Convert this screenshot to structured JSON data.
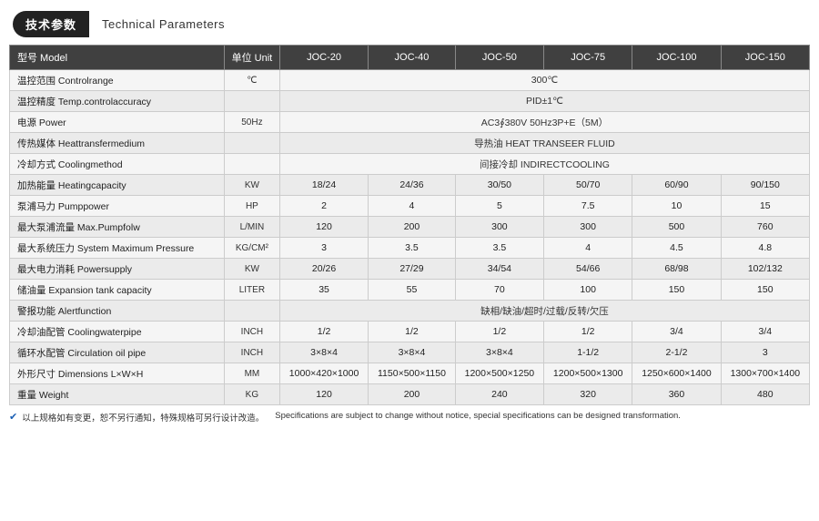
{
  "header": {
    "badge": "技术参数",
    "title": "Technical Parameters"
  },
  "table": {
    "columns": [
      "型号 Model",
      "单位 Unit",
      "JOC-20",
      "JOC-40",
      "JOC-50",
      "JOC-75",
      "JOC-100",
      "JOC-150"
    ],
    "rows": [
      {
        "label": "温控范围 Controlrange",
        "unit": "℃",
        "merged": true,
        "mergedValue": "300℃",
        "cols": 6
      },
      {
        "label": "温控精度 Temp.controlaccuracy",
        "unit": "",
        "merged": true,
        "mergedValue": "PID±1℃",
        "cols": 6
      },
      {
        "label": "电源 Power",
        "unit": "50Hz",
        "merged": true,
        "mergedValue": "AC3∮380V 50Hz3P+E（5M）",
        "cols": 6
      },
      {
        "label": "传热媒体 Heattransfermedium",
        "unit": "",
        "merged": true,
        "mergedValue": "导热油 HEAT TRANSEER FLUID",
        "cols": 6
      },
      {
        "label": "冷却方式 Coolingmethod",
        "unit": "",
        "merged": true,
        "mergedValue": "间接冷却 INDIRECTCOOLING",
        "cols": 6
      },
      {
        "label": "加热能量 Heatingcapacity",
        "unit": "KW",
        "merged": false,
        "values": [
          "18/24",
          "24/36",
          "30/50",
          "50/70",
          "60/90",
          "90/150"
        ]
      },
      {
        "label": "泵浦马力 Pumppower",
        "unit": "HP",
        "merged": false,
        "values": [
          "2",
          "4",
          "5",
          "7.5",
          "10",
          "15"
        ]
      },
      {
        "label": "最大泵浦流量 Max.Pumpfolw",
        "unit": "L/MIN",
        "merged": false,
        "values": [
          "120",
          "200",
          "300",
          "300",
          "500",
          "760"
        ]
      },
      {
        "label": "最大系统压力 System Maximum Pressure",
        "unit": "KG/CM²",
        "merged": false,
        "values": [
          "3",
          "3.5",
          "3.5",
          "4",
          "4.5",
          "4.8"
        ]
      },
      {
        "label": "最大电力消耗 Powersupply",
        "unit": "KW",
        "merged": false,
        "values": [
          "20/26",
          "27/29",
          "34/54",
          "54/66",
          "68/98",
          "102/132"
        ]
      },
      {
        "label": "储油量 Expansion tank capacity",
        "unit": "LITER",
        "merged": false,
        "values": [
          "35",
          "55",
          "70",
          "100",
          "150",
          "150"
        ]
      },
      {
        "label": "警报功能 Alertfunction",
        "unit": "",
        "merged": true,
        "mergedValue": "缺相/缺油/超时/过载/反转/欠压",
        "cols": 6
      },
      {
        "label": "冷却油配管 Coolingwaterpipe",
        "unit": "INCH",
        "merged": false,
        "values": [
          "1/2",
          "1/2",
          "1/2",
          "1/2",
          "3/4",
          "3/4"
        ]
      },
      {
        "label": "循环水配管 Circulation oil pipe",
        "unit": "INCH",
        "merged": false,
        "values": [
          "3×8×4",
          "3×8×4",
          "3×8×4",
          "1-1/2",
          "2-1/2",
          "3"
        ]
      },
      {
        "label": "外形尺寸 Dimensions L×W×H",
        "unit": "MM",
        "merged": false,
        "values": [
          "1000×420×1000",
          "1150×500×1150",
          "1200×500×1250",
          "1200×500×1300",
          "1250×600×1400",
          "1300×700×1400"
        ]
      },
      {
        "label": "重量 Weight",
        "unit": "KG",
        "merged": false,
        "values": [
          "120",
          "200",
          "240",
          "320",
          "360",
          "480"
        ]
      }
    ]
  },
  "footer": {
    "check_icon": "✔",
    "cn_text": "以上规格如有变更，恕不另行通知，特殊规格可另行设计改造。",
    "en_text": "Specifications are subject to change without notice, special specifications can be designed transformation."
  }
}
